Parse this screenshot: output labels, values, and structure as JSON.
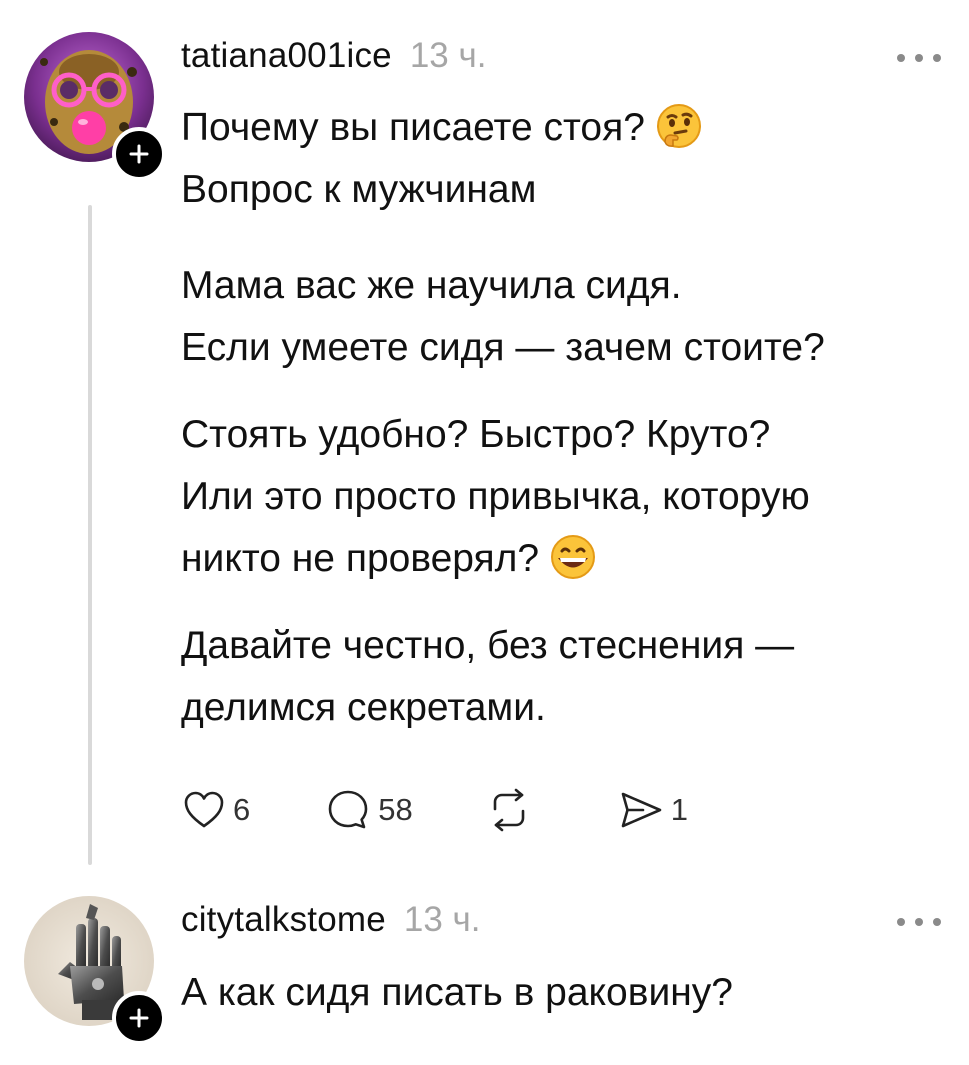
{
  "posts": [
    {
      "username": "tatiana001ice",
      "time": "13 ч.",
      "paragraphs": [
        [
          "Почему вы писаете стоя?",
          "Вопрос к мужчинам"
        ],
        [
          "Мама вас же научила сидя.",
          "Если умеете сидя — зачем стоите?"
        ],
        [
          "Стоять удобно? Быстро? Круто?",
          "Или это просто привычка, которую",
          "никто не проверял?"
        ],
        [
          "Давайте честно, без стеснения —",
          "делимся секретами."
        ]
      ],
      "emojis": [
        "thinking-face-emoji",
        "grinning-face-emoji"
      ],
      "actions": {
        "likes": "6",
        "comments": "58",
        "shares": "1"
      },
      "avatar": "purple-leopard-face-with-pink-glasses-and-gum"
    },
    {
      "username": "citytalkstome",
      "time": "13 ч.",
      "text": "А как сидя писать в раковину?",
      "avatar": "metal-hand-sculpture"
    }
  ],
  "icons": [
    "heart-icon",
    "comment-icon",
    "repost-icon",
    "send-icon",
    "more-icon",
    "plus-icon"
  ],
  "colors": {
    "text": "#111111",
    "muted": "#a6a6a6",
    "thread_line": "#d9d9d9",
    "badge": "#000000"
  }
}
